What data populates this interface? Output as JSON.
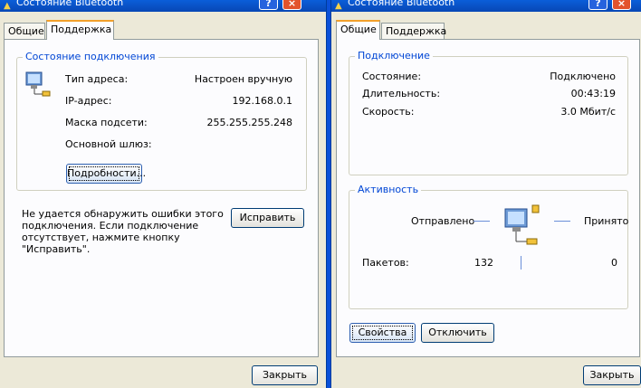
{
  "left_window": {
    "title": "Состояние Bluetooth",
    "tabs": [
      "Общие",
      "Поддержка"
    ],
    "group_title": "Состояние подключения",
    "rows": [
      {
        "label": "Тип адреса:",
        "value": "Настроен вручную"
      },
      {
        "label": "IP-адрес:",
        "value": "192.168.0.1"
      },
      {
        "label": "Маска подсети:",
        "value": "255.255.255.248"
      },
      {
        "label": "Основной шлюз:",
        "value": ""
      }
    ],
    "details_button": "Подробности...",
    "repair_text": "Не удается обнаружить ошибки этого подключения. Если подключение отсутствует, нажмите кнопку \"Исправить\".",
    "repair_button": "Исправить",
    "close_button": "Закрыть"
  },
  "right_window": {
    "title": "Состояние Bluetooth",
    "tabs": [
      "Общие",
      "Поддержка"
    ],
    "connection_group_title": "Подключение",
    "connection_rows": [
      {
        "label": "Состояние:",
        "value": "Подключено"
      },
      {
        "label": "Длительность:",
        "value": "00:43:19"
      },
      {
        "label": "Скорость:",
        "value": "3.0 Мбит/с"
      }
    ],
    "activity_group_title": "Активность",
    "sent_label": "Отправлено",
    "received_label": "Принято",
    "packets_label": "Пакетов:",
    "packets_sent": "132",
    "packets_received": "0",
    "properties_button": "Свойства",
    "disable_button": "Отключить",
    "close_button": "Закрыть"
  },
  "titlebar_buttons": {
    "help": "?",
    "close": "×"
  },
  "icons": {
    "window": "bluetooth-icon",
    "network": "network-computers-icon"
  }
}
